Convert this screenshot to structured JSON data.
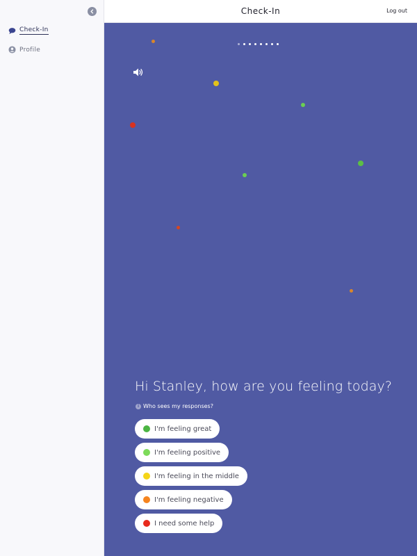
{
  "sidebar": {
    "collapse_icon": "chevron-left-icon",
    "items": [
      {
        "label": "Check-In",
        "icon": "chat-bubble-icon",
        "active": true
      },
      {
        "label": "Profile",
        "icon": "user-circle-icon",
        "active": false
      }
    ]
  },
  "header": {
    "title": "Check-In",
    "logout_label": "Log out"
  },
  "main": {
    "background": "#505aa3",
    "progress": {
      "total_steps": 8,
      "current_step": 1
    },
    "speaker_icon": "speaker-icon",
    "question": "Hi Stanley, how are you feeling today?",
    "who_sees_label": "Who sees my responses?",
    "options": [
      {
        "label": "I'm feeling great",
        "color": "#4cb543"
      },
      {
        "label": "I'm feeling positive",
        "color": "#7ddb5a"
      },
      {
        "label": "I'm feeling in the middle",
        "color": "#f5d518"
      },
      {
        "label": "I'm feeling negative",
        "color": "#f5841f"
      },
      {
        "label": "I need some help",
        "color": "#e82a1c"
      }
    ]
  }
}
